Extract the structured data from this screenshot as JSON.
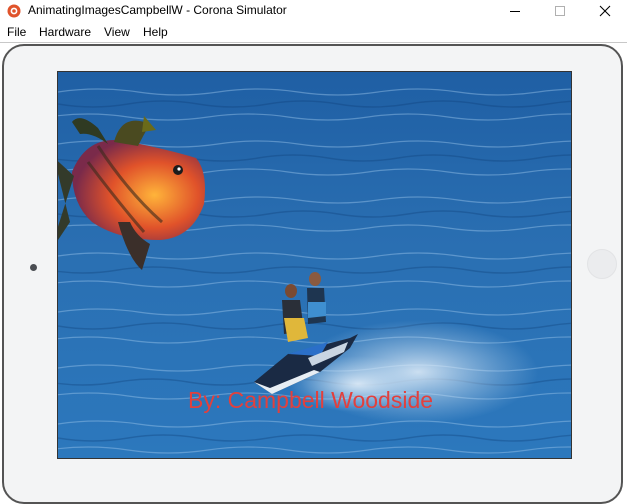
{
  "window": {
    "title": "AnimatingImagesCampbellW - Corona Simulator",
    "controls": [
      "minimize-icon",
      "maximize-icon",
      "close-icon"
    ]
  },
  "menu": {
    "items": [
      {
        "label": "File"
      },
      {
        "label": "Hardware"
      },
      {
        "label": "View"
      },
      {
        "label": "Help"
      }
    ]
  },
  "app": {
    "credit_text": "By: Campbell Woodside",
    "credit_color": "#e2403d"
  },
  "colors": {
    "sea": "#2a6fb2",
    "bezel": "#f3f4f5",
    "bezel_border": "#545454",
    "accent_icon": "#e0532b"
  }
}
